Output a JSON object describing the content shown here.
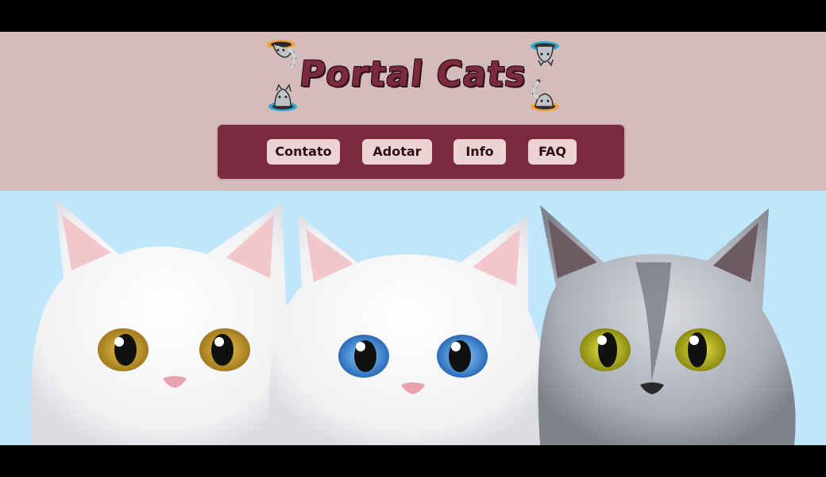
{
  "header": {
    "title": "Portal Cats",
    "icons": [
      "portal-cat-icon-top-left",
      "portal-cat-icon-bottom-left",
      "portal-cat-icon-top-right",
      "portal-cat-icon-bottom-right"
    ]
  },
  "nav": {
    "items": [
      {
        "label": "Contato"
      },
      {
        "label": "Adotar"
      },
      {
        "label": "Info"
      },
      {
        "label": "FAQ"
      }
    ]
  },
  "hero": {
    "image_subject": "three-kittens-banner"
  },
  "colors": {
    "header_bg": "#d4bcbd",
    "nav_bg": "#7b2a42",
    "button_bg": "#ecd3d4",
    "hero_bg": "#bfe6fb"
  }
}
